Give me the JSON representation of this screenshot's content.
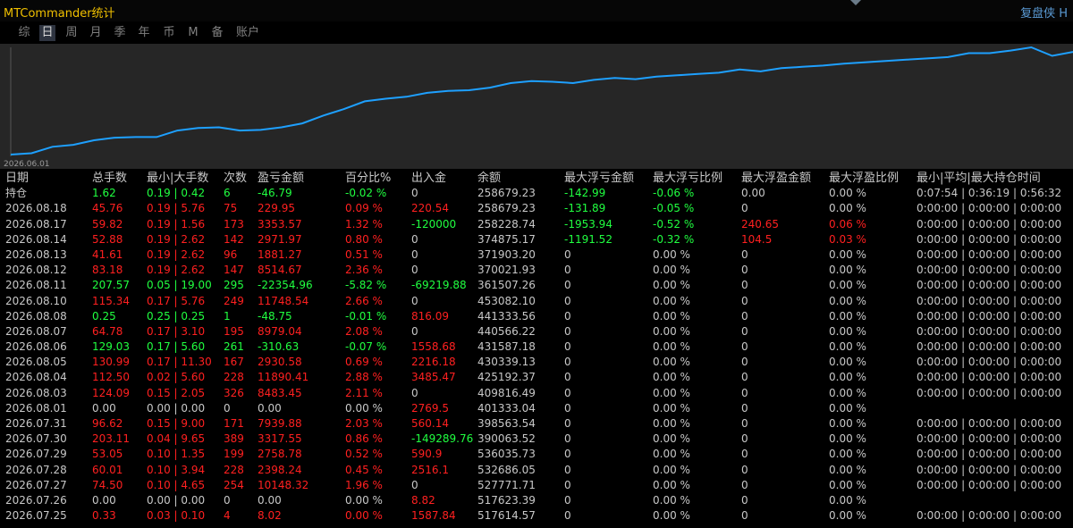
{
  "app": {
    "title": "MTCommander统计",
    "right_title": "复盘侠 H"
  },
  "tabs": [
    {
      "label": "综",
      "active": false
    },
    {
      "label": "日",
      "active": true
    },
    {
      "label": "周",
      "active": false
    },
    {
      "label": "月",
      "active": false
    },
    {
      "label": "季",
      "active": false
    },
    {
      "label": "年",
      "active": false
    },
    {
      "label": "币",
      "active": false
    },
    {
      "label": "M",
      "active": false
    },
    {
      "label": "备",
      "active": false
    },
    {
      "label": "账户",
      "active": false
    }
  ],
  "colors": {
    "positive": "#ff2020",
    "negative": "#20ff40",
    "neutral": "#c8c8c8",
    "line": "#1ea0ff",
    "title": "#f0c000"
  },
  "chart_data": {
    "type": "line",
    "x_start_label": "2026.06.01",
    "series": [
      {
        "values": [
          0,
          2,
          12,
          15,
          22,
          26,
          27,
          27,
          37,
          41,
          42,
          37,
          38,
          42,
          48,
          60,
          70,
          82,
          86,
          89,
          95,
          98,
          99,
          103,
          110,
          113,
          112,
          110,
          115,
          118,
          116,
          120,
          122,
          124,
          126,
          131,
          128,
          133,
          135,
          137,
          140,
          142,
          144,
          146,
          148,
          150,
          156,
          156,
          160,
          165,
          152,
          158
        ]
      }
    ]
  },
  "table": {
    "columns": [
      "日期",
      "总手数",
      "最小|大手数",
      "次数",
      "盈亏金额",
      "百分比%",
      "出入金",
      "余额",
      "最大浮亏金额",
      "最大浮亏比例",
      "最大浮盈金额",
      "最大浮盈比例",
      "最小|平均|最大持仓时间"
    ],
    "rows": [
      {
        "date": "持仓",
        "lots": "1.62",
        "minmax": "0.19 | 0.42",
        "count": "6",
        "pnl": "-46.79",
        "pct": "-0.02 %",
        "flow": "0",
        "balance": "258679.23",
        "max_float_loss": "-142.99",
        "max_float_loss_pct": "-0.06 %",
        "max_float_profit": "0.00",
        "max_float_profit_pct": "0.00 %",
        "hold_time": "0:07:54 | 0:36:19 | 0:56:32",
        "tone": "neg",
        "flow_tone": "neu",
        "fl_tone": "neg",
        "fp_tone": "neu"
      },
      {
        "date": "2026.08.18",
        "lots": "45.76",
        "minmax": "0.19 | 5.76",
        "count": "75",
        "pnl": "229.95",
        "pct": "0.09 %",
        "flow": "220.54",
        "balance": "258679.23",
        "max_float_loss": "-131.89",
        "max_float_loss_pct": "-0.05 %",
        "max_float_profit": "0",
        "max_float_profit_pct": "0.00 %",
        "hold_time": "0:00:00 | 0:00:00 | 0:00:00",
        "tone": "pos",
        "flow_tone": "pos",
        "fl_tone": "neg",
        "fp_tone": "neu"
      },
      {
        "date": "2026.08.17",
        "lots": "59.82",
        "minmax": "0.19 | 1.56",
        "count": "173",
        "pnl": "3353.57",
        "pct": "1.32 %",
        "flow": "-120000",
        "balance": "258228.74",
        "max_float_loss": "-1953.94",
        "max_float_loss_pct": "-0.52 %",
        "max_float_profit": "240.65",
        "max_float_profit_pct": "0.06 %",
        "hold_time": "0:00:00 | 0:00:00 | 0:00:00",
        "tone": "pos",
        "flow_tone": "neg",
        "fl_tone": "neg",
        "fp_tone": "pos"
      },
      {
        "date": "2026.08.14",
        "lots": "52.88",
        "minmax": "0.19 | 2.62",
        "count": "142",
        "pnl": "2971.97",
        "pct": "0.80 %",
        "flow": "0",
        "balance": "374875.17",
        "max_float_loss": "-1191.52",
        "max_float_loss_pct": "-0.32 %",
        "max_float_profit": "104.5",
        "max_float_profit_pct": "0.03 %",
        "hold_time": "0:00:00 | 0:00:00 | 0:00:00",
        "tone": "pos",
        "flow_tone": "neu",
        "fl_tone": "neg",
        "fp_tone": "pos"
      },
      {
        "date": "2026.08.13",
        "lots": "41.61",
        "minmax": "0.19 | 2.62",
        "count": "96",
        "pnl": "1881.27",
        "pct": "0.51 %",
        "flow": "0",
        "balance": "371903.20",
        "max_float_loss": "0",
        "max_float_loss_pct": "0.00 %",
        "max_float_profit": "0",
        "max_float_profit_pct": "0.00 %",
        "hold_time": "0:00:00 | 0:00:00 | 0:00:00",
        "tone": "pos",
        "flow_tone": "neu",
        "fl_tone": "neu",
        "fp_tone": "neu"
      },
      {
        "date": "2026.08.12",
        "lots": "83.18",
        "minmax": "0.19 | 2.62",
        "count": "147",
        "pnl": "8514.67",
        "pct": "2.36 %",
        "flow": "0",
        "balance": "370021.93",
        "max_float_loss": "0",
        "max_float_loss_pct": "0.00 %",
        "max_float_profit": "0",
        "max_float_profit_pct": "0.00 %",
        "hold_time": "0:00:00 | 0:00:00 | 0:00:00",
        "tone": "pos",
        "flow_tone": "neu",
        "fl_tone": "neu",
        "fp_tone": "neu"
      },
      {
        "date": "2026.08.11",
        "lots": "207.57",
        "minmax": "0.05 | 19.00",
        "count": "295",
        "pnl": "-22354.96",
        "pct": "-5.82 %",
        "flow": "-69219.88",
        "balance": "361507.26",
        "max_float_loss": "0",
        "max_float_loss_pct": "0.00 %",
        "max_float_profit": "0",
        "max_float_profit_pct": "0.00 %",
        "hold_time": "0:00:00 | 0:00:00 | 0:00:00",
        "tone": "neg",
        "flow_tone": "neg",
        "fl_tone": "neu",
        "fp_tone": "neu"
      },
      {
        "date": "2026.08.10",
        "lots": "115.34",
        "minmax": "0.17 | 5.76",
        "count": "249",
        "pnl": "11748.54",
        "pct": "2.66 %",
        "flow": "0",
        "balance": "453082.10",
        "max_float_loss": "0",
        "max_float_loss_pct": "0.00 %",
        "max_float_profit": "0",
        "max_float_profit_pct": "0.00 %",
        "hold_time": "0:00:00 | 0:00:00 | 0:00:00",
        "tone": "pos",
        "flow_tone": "neu",
        "fl_tone": "neu",
        "fp_tone": "neu"
      },
      {
        "date": "2026.08.08",
        "lots": "0.25",
        "minmax": "0.25 | 0.25",
        "count": "1",
        "pnl": "-48.75",
        "pct": "-0.01 %",
        "flow": "816.09",
        "balance": "441333.56",
        "max_float_loss": "0",
        "max_float_loss_pct": "0.00 %",
        "max_float_profit": "0",
        "max_float_profit_pct": "0.00 %",
        "hold_time": "0:00:00 | 0:00:00 | 0:00:00",
        "tone": "neg",
        "flow_tone": "pos",
        "fl_tone": "neu",
        "fp_tone": "neu"
      },
      {
        "date": "2026.08.07",
        "lots": "64.78",
        "minmax": "0.17 | 3.10",
        "count": "195",
        "pnl": "8979.04",
        "pct": "2.08 %",
        "flow": "0",
        "balance": "440566.22",
        "max_float_loss": "0",
        "max_float_loss_pct": "0.00 %",
        "max_float_profit": "0",
        "max_float_profit_pct": "0.00 %",
        "hold_time": "0:00:00 | 0:00:00 | 0:00:00",
        "tone": "pos",
        "flow_tone": "neu",
        "fl_tone": "neu",
        "fp_tone": "neu"
      },
      {
        "date": "2026.08.06",
        "lots": "129.03",
        "minmax": "0.17 | 5.60",
        "count": "261",
        "pnl": "-310.63",
        "pct": "-0.07 %",
        "flow": "1558.68",
        "balance": "431587.18",
        "max_float_loss": "0",
        "max_float_loss_pct": "0.00 %",
        "max_float_profit": "0",
        "max_float_profit_pct": "0.00 %",
        "hold_time": "0:00:00 | 0:00:00 | 0:00:00",
        "tone": "neg",
        "flow_tone": "pos",
        "fl_tone": "neu",
        "fp_tone": "neu"
      },
      {
        "date": "2026.08.05",
        "lots": "130.99",
        "minmax": "0.17 | 11.30",
        "count": "167",
        "pnl": "2930.58",
        "pct": "0.69 %",
        "flow": "2216.18",
        "balance": "430339.13",
        "max_float_loss": "0",
        "max_float_loss_pct": "0.00 %",
        "max_float_profit": "0",
        "max_float_profit_pct": "0.00 %",
        "hold_time": "0:00:00 | 0:00:00 | 0:00:00",
        "tone": "pos",
        "flow_tone": "pos",
        "fl_tone": "neu",
        "fp_tone": "neu"
      },
      {
        "date": "2026.08.04",
        "lots": "112.50",
        "minmax": "0.02 | 5.60",
        "count": "228",
        "pnl": "11890.41",
        "pct": "2.88 %",
        "flow": "3485.47",
        "balance": "425192.37",
        "max_float_loss": "0",
        "max_float_loss_pct": "0.00 %",
        "max_float_profit": "0",
        "max_float_profit_pct": "0.00 %",
        "hold_time": "0:00:00 | 0:00:00 | 0:00:00",
        "tone": "pos",
        "flow_tone": "pos",
        "fl_tone": "neu",
        "fp_tone": "neu"
      },
      {
        "date": "2026.08.03",
        "lots": "124.09",
        "minmax": "0.15 | 2.05",
        "count": "326",
        "pnl": "8483.45",
        "pct": "2.11 %",
        "flow": "0",
        "balance": "409816.49",
        "max_float_loss": "0",
        "max_float_loss_pct": "0.00 %",
        "max_float_profit": "0",
        "max_float_profit_pct": "0.00 %",
        "hold_time": "0:00:00 | 0:00:00 | 0:00:00",
        "tone": "pos",
        "flow_tone": "neu",
        "fl_tone": "neu",
        "fp_tone": "neu"
      },
      {
        "date": "2026.08.01",
        "lots": "0.00",
        "minmax": "0.00 | 0.00",
        "count": "0",
        "pnl": "0.00",
        "pct": "0.00 %",
        "flow": "2769.5",
        "balance": "401333.04",
        "max_float_loss": "0",
        "max_float_loss_pct": "0.00 %",
        "max_float_profit": "0",
        "max_float_profit_pct": "0.00 %",
        "hold_time": "",
        "tone": "neu",
        "flow_tone": "pos",
        "fl_tone": "neu",
        "fp_tone": "neu"
      },
      {
        "date": "2026.07.31",
        "lots": "96.62",
        "minmax": "0.15 | 9.00",
        "count": "171",
        "pnl": "7939.88",
        "pct": "2.03 %",
        "flow": "560.14",
        "balance": "398563.54",
        "max_float_loss": "0",
        "max_float_loss_pct": "0.00 %",
        "max_float_profit": "0",
        "max_float_profit_pct": "0.00 %",
        "hold_time": "0:00:00 | 0:00:00 | 0:00:00",
        "tone": "pos",
        "flow_tone": "pos",
        "fl_tone": "neu",
        "fp_tone": "neu"
      },
      {
        "date": "2026.07.30",
        "lots": "203.11",
        "minmax": "0.04 | 9.65",
        "count": "389",
        "pnl": "3317.55",
        "pct": "0.86 %",
        "flow": "-149289.76",
        "balance": "390063.52",
        "max_float_loss": "0",
        "max_float_loss_pct": "0.00 %",
        "max_float_profit": "0",
        "max_float_profit_pct": "0.00 %",
        "hold_time": "0:00:00 | 0:00:00 | 0:00:00",
        "tone": "pos",
        "flow_tone": "neg",
        "fl_tone": "neu",
        "fp_tone": "neu"
      },
      {
        "date": "2026.07.29",
        "lots": "53.05",
        "minmax": "0.10 | 1.35",
        "count": "199",
        "pnl": "2758.78",
        "pct": "0.52 %",
        "flow": "590.9",
        "balance": "536035.73",
        "max_float_loss": "0",
        "max_float_loss_pct": "0.00 %",
        "max_float_profit": "0",
        "max_float_profit_pct": "0.00 %",
        "hold_time": "0:00:00 | 0:00:00 | 0:00:00",
        "tone": "pos",
        "flow_tone": "pos",
        "fl_tone": "neu",
        "fp_tone": "neu"
      },
      {
        "date": "2026.07.28",
        "lots": "60.01",
        "minmax": "0.10 | 3.94",
        "count": "228",
        "pnl": "2398.24",
        "pct": "0.45 %",
        "flow": "2516.1",
        "balance": "532686.05",
        "max_float_loss": "0",
        "max_float_loss_pct": "0.00 %",
        "max_float_profit": "0",
        "max_float_profit_pct": "0.00 %",
        "hold_time": "0:00:00 | 0:00:00 | 0:00:00",
        "tone": "pos",
        "flow_tone": "pos",
        "fl_tone": "neu",
        "fp_tone": "neu"
      },
      {
        "date": "2026.07.27",
        "lots": "74.50",
        "minmax": "0.10 | 4.65",
        "count": "254",
        "pnl": "10148.32",
        "pct": "1.96 %",
        "flow": "0",
        "balance": "527771.71",
        "max_float_loss": "0",
        "max_float_loss_pct": "0.00 %",
        "max_float_profit": "0",
        "max_float_profit_pct": "0.00 %",
        "hold_time": "0:00:00 | 0:00:00 | 0:00:00",
        "tone": "pos",
        "flow_tone": "neu",
        "fl_tone": "neu",
        "fp_tone": "neu"
      },
      {
        "date": "2026.07.26",
        "lots": "0.00",
        "minmax": "0.00 | 0.00",
        "count": "0",
        "pnl": "0.00",
        "pct": "0.00 %",
        "flow": "8.82",
        "balance": "517623.39",
        "max_float_loss": "0",
        "max_float_loss_pct": "0.00 %",
        "max_float_profit": "0",
        "max_float_profit_pct": "0.00 %",
        "hold_time": "",
        "tone": "neu",
        "flow_tone": "pos",
        "fl_tone": "neu",
        "fp_tone": "neu"
      },
      {
        "date": "2026.07.25",
        "lots": "0.33",
        "minmax": "0.03 | 0.10",
        "count": "4",
        "pnl": "8.02",
        "pct": "0.00 %",
        "flow": "1587.84",
        "balance": "517614.57",
        "max_float_loss": "0",
        "max_float_loss_pct": "0.00 %",
        "max_float_profit": "0",
        "max_float_profit_pct": "0.00 %",
        "hold_time": "0:00:00 | 0:00:00 | 0:00:00",
        "tone": "pos",
        "flow_tone": "pos",
        "fl_tone": "neu",
        "fp_tone": "neu"
      }
    ]
  }
}
